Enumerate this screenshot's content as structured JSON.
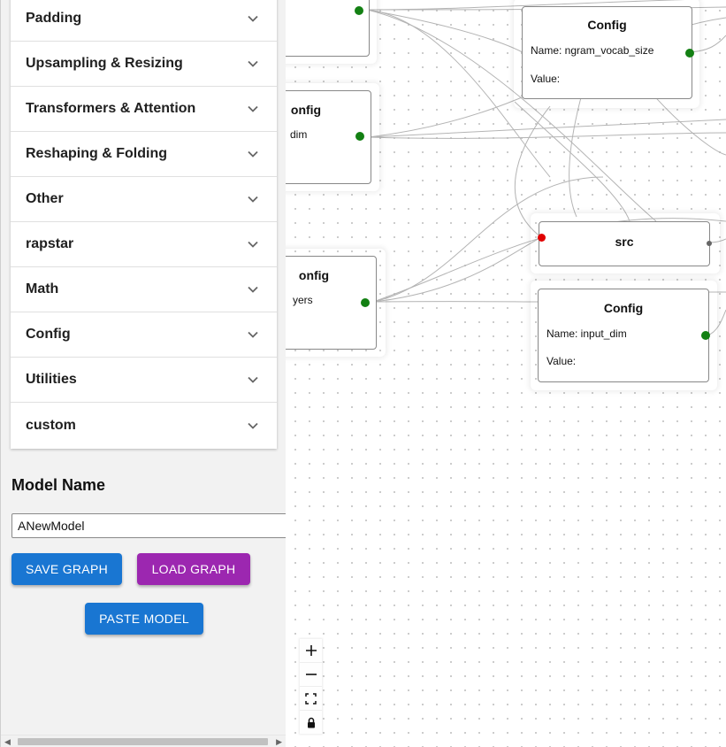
{
  "sidebar": {
    "accordion": [
      {
        "label": "Padding"
      },
      {
        "label": "Upsampling & Resizing"
      },
      {
        "label": "Transformers & Attention"
      },
      {
        "label": "Reshaping & Folding"
      },
      {
        "label": "Other"
      },
      {
        "label": "rapstar"
      },
      {
        "label": "Math"
      },
      {
        "label": "Config"
      },
      {
        "label": "Utilities"
      },
      {
        "label": "custom"
      }
    ],
    "model_name_title": "Model Name",
    "model_name_value": "ANewModel",
    "save_label": "SAVE GRAPH",
    "load_label": "LOAD GRAPH",
    "paste_label": "PASTE MODEL"
  },
  "canvas": {
    "nodes": {
      "partial_top": {},
      "partial_mid": {
        "title": "onfig",
        "line1": "dim"
      },
      "partial_low": {
        "title": "onfig",
        "line1": "yers"
      },
      "config_top": {
        "title": "Config",
        "name": "Name: ngram_vocab_size",
        "value": "Value:"
      },
      "src": {
        "title": "src"
      },
      "config_input": {
        "title": "Config",
        "name": "Name: input_dim",
        "value": "Value:"
      }
    }
  },
  "controls": {
    "zoom_in": "plus-icon",
    "zoom_out": "minus-icon",
    "fit_view": "fit-view-icon",
    "lock": "lock-icon"
  },
  "colors": {
    "save_button": "#1976d2",
    "load_button": "#9c27b0",
    "handle_output": "#138013",
    "handle_input": "#e00000"
  }
}
